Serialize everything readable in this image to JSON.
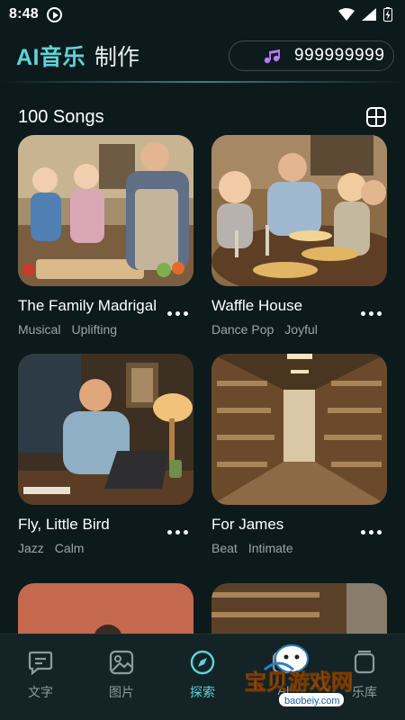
{
  "status": {
    "time": "8:48"
  },
  "header": {
    "brand": "AI音乐",
    "subtitle": "制作",
    "credits": "999999999"
  },
  "section": {
    "title": "100 Songs"
  },
  "songs": [
    {
      "title": "The Family Madrigal",
      "tags": [
        "Musical",
        "Uplifting"
      ]
    },
    {
      "title": "Waffle House",
      "tags": [
        "Dance Pop",
        "Joyful"
      ]
    },
    {
      "title": "Fly, Little Bird",
      "tags": [
        "Jazz",
        "Calm"
      ]
    },
    {
      "title": "For James",
      "tags": [
        "Beat",
        "Intimate"
      ]
    }
  ],
  "nav": [
    {
      "label": "文字",
      "icon": "text-icon"
    },
    {
      "label": "图片",
      "icon": "image-icon"
    },
    {
      "label": "探索",
      "icon": "compass-icon",
      "active": true
    },
    {
      "label": "AI",
      "icon": "ai-icon"
    },
    {
      "label": "乐库",
      "icon": "library-icon"
    }
  ],
  "watermark": {
    "text": "宝贝游戏网",
    "url": "baobeiy.com"
  },
  "colors": {
    "accent": "#5fd3d9",
    "background": "#0d1a1c",
    "nav_bg": "#142426"
  }
}
